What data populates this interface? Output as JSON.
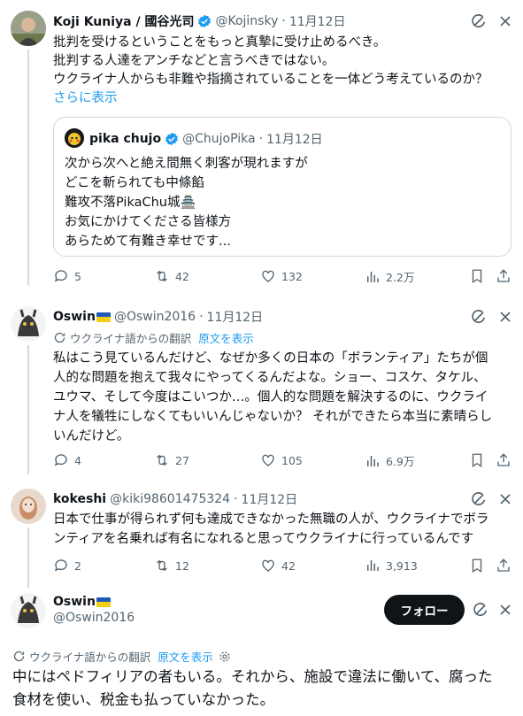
{
  "tweet1": {
    "name": "Koji Kuniya / 國谷光司",
    "handle": "@Kojinsky",
    "dot": "·",
    "date": "11月12日",
    "lines": [
      "批判を受けるということをもっと真摯に受け止めるべき。",
      "批判する人達をアンチなどと言うべきではない。",
      "ウクライナ人からも非難や指摘されていることを一体どう考えているのか？"
    ],
    "show_more": "さらに表示",
    "quote": {
      "name": "pika chujo",
      "handle": "@ChujoPika",
      "dot": "·",
      "date": "11月12日",
      "lines": [
        "次から次へと絶え間無く刺客が現れますが",
        "どこを斬られても中條餡",
        "難攻不落PikaChu城🏯",
        "お気にかけてくださる皆様方",
        "あらためて有難き幸せです..."
      ]
    },
    "stats": {
      "replies": "5",
      "retweets": "42",
      "likes": "132",
      "views": "2.2万"
    }
  },
  "tweet2": {
    "name": "Oswin",
    "handle": "@Oswin2016",
    "dot": "·",
    "date": "11月12日",
    "translated_label": "ウクライナ語からの翻訳",
    "original_link": "原文を表示",
    "lines": [
      "私はこう見ているんだけど、なぜか多くの日本の「ボランティア」たちが個",
      "人的な問題を抱えて我々にやってくるんだよな。ショー、コスケ、タケル、",
      "ユウマ、そして今度はこいつか…。個人的な問題を解決するのに、ウクライ",
      "ナ人を犠牲にしなくてもいいんじゃないか？ それができたら本当に素晴らし",
      "いんだけど。"
    ],
    "stats": {
      "replies": "4",
      "retweets": "27",
      "likes": "105",
      "views": "6.9万"
    }
  },
  "tweet3": {
    "name": "kokeshi",
    "handle": "@kiki98601475324",
    "dot": "·",
    "date": "11月12日",
    "lines": [
      "日本で仕事が得られず何も達成できなかった無職の人が、ウクライナでボラ",
      "ンティアを名乗れば有名になれると思ってウクライナに行っているんです"
    ],
    "stats": {
      "replies": "2",
      "retweets": "12",
      "likes": "42",
      "views": "3,913"
    }
  },
  "tweet4": {
    "name": "Oswin",
    "handle": "@Oswin2016",
    "follow_label": "フォロー",
    "translated_label": "ウクライナ語からの翻訳",
    "original_link": "原文を表示",
    "lines": [
      "中にはペドフィリアの者もいる。それから、施設で違法に働いて、腐った",
      "食材を使い、税金も払っていなかった。"
    ]
  },
  "colors": {
    "accent": "#1d9bf0",
    "text": "#0f1419",
    "muted": "#536471",
    "border": "#cfd9de"
  },
  "icons": [
    "verified-badge-icon",
    "grok-icon",
    "more-icon",
    "reply-icon",
    "retweet-icon",
    "like-icon",
    "views-icon",
    "bookmark-icon",
    "share-icon",
    "translate-icon",
    "settings-icon",
    "ukraine-flag-icon"
  ]
}
